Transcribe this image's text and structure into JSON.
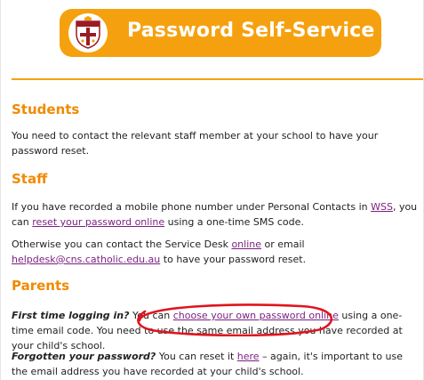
{
  "banner": {
    "title": "Password Self-Service"
  },
  "students": {
    "heading": "Students",
    "text": "You need to contact the relevant staff member at your school to have your password reset."
  },
  "staff": {
    "heading": "Staff",
    "p1_before": "If you have recorded a mobile phone number under Personal Contacts in ",
    "p1_link1": "WSS",
    "p1_middle": ", you can ",
    "p1_link2": "reset your password online",
    "p1_after": " using a one-time SMS code.",
    "p2_before": "Otherwise you can contact the Service Desk ",
    "p2_link1": "online",
    "p2_middle": " or email ",
    "p2_link2": "helpdesk@cns.catholic.edu.au",
    "p2_after": " to have your password reset."
  },
  "parents": {
    "heading": "Parents",
    "p1_bold": "First time logging in?",
    "p1_before": " You can ",
    "p1_link": "choose your own password online",
    "p1_after": " using a one-time email code. You need to use the same email address you have recorded at your child's school.",
    "p2_bold": "Forgotten your password?",
    "p2_before": " You can reset it ",
    "p2_link": "here",
    "p2_after": " – again, it's important to use the email address you have recorded at your child's school."
  },
  "colors": {
    "accent": "#f5a10f",
    "heading": "#f08a00",
    "link": "#7a1f7f",
    "annotation": "#e0141e"
  },
  "icons": {
    "logo": "school-crest-icon"
  }
}
